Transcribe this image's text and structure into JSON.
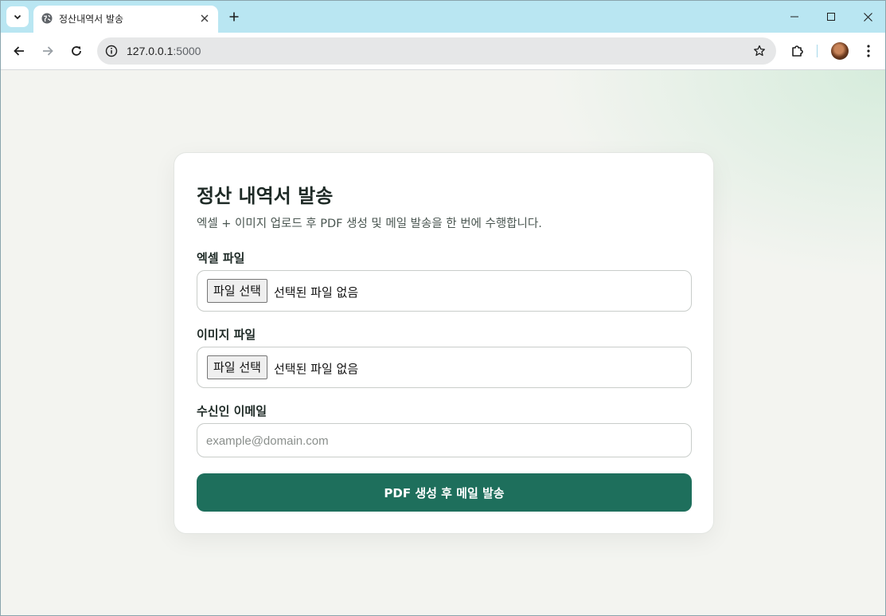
{
  "browser": {
    "tab_title": "정산내역서 발송",
    "url_host": "127.0.0.1",
    "url_port": ":5000"
  },
  "page": {
    "title": "정산 내역서 발송",
    "subtitle": "엑셀 + 이미지 업로드 후 PDF 생성 및 메일 발송을 한 번에 수행합니다.",
    "excel_label": "엑셀 파일",
    "image_label": "이미지 파일",
    "file_button_label": "파일 선택",
    "no_file_text": "선택된 파일 없음",
    "email_label": "수신인 이메일",
    "email_value": "",
    "email_placeholder": "example@domain.com",
    "submit_label": "PDF 생성 후 메일 발송"
  },
  "colors": {
    "tab_strip": "#b9e6f2",
    "primary_button": "#1e6f5c",
    "page_background": "#f3f4f0"
  }
}
